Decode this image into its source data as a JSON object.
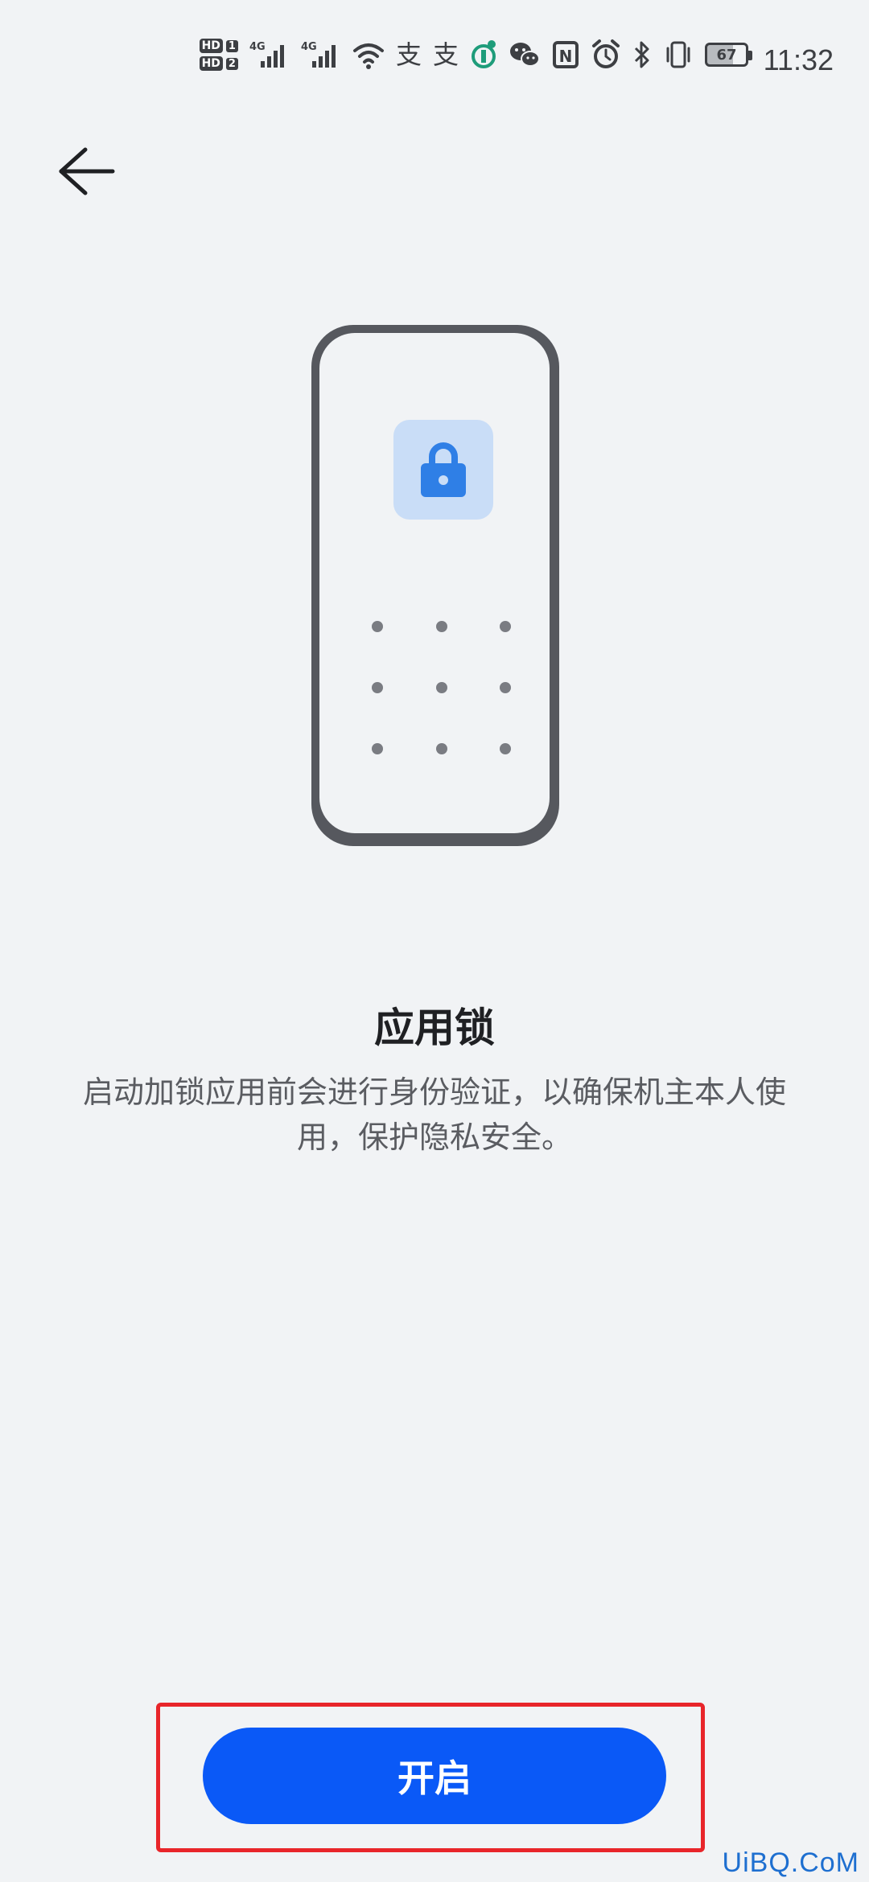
{
  "status_bar": {
    "sim1_label": "HD",
    "sim1_num": "1",
    "sim2_label": "HD",
    "sim2_num": "2",
    "network1": "4G",
    "network2": "4G",
    "alipay_glyph_1": "支",
    "alipay_glyph_2": "支",
    "nfc_glyph": "N",
    "battery_level": "67",
    "time": "11:32"
  },
  "page": {
    "title": "应用锁",
    "description": "启动加锁应用前会进行身份验证，以确保机主本人使用，保护隐私安全。"
  },
  "actions": {
    "enable_label": "开启"
  },
  "watermark": "UiBQ.CoM",
  "colors": {
    "background": "#f1f3f5",
    "primary_button": "#0a59f7",
    "highlight_border": "#e8252a",
    "lock_icon": "#2f7fe6",
    "lock_tile": "#c9ddf7"
  }
}
